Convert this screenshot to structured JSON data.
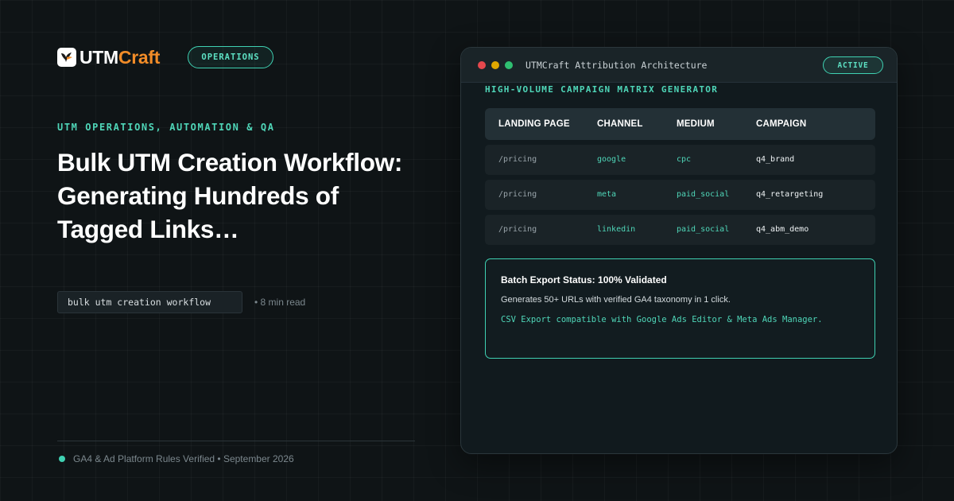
{
  "brand": {
    "name_part1": "UTM",
    "name_part2": "Craft",
    "logo_icon": "bird-icon",
    "category_pill": "OPERATIONS"
  },
  "article": {
    "eyebrow": "UTM OPERATIONS, AUTOMATION & QA",
    "headline": "Bulk UTM Creation Workflow: Generating Hundreds of Tagged Links…",
    "keyword": "bulk utm creation workflow",
    "read_time": "• 8 min read"
  },
  "footer": {
    "text": "GA4 & Ad Platform Rules Verified • September 2026"
  },
  "window": {
    "title": "UTMCraft Attribution Architecture",
    "status_pill": "ACTIVE",
    "section_label": "HIGH-VOLUME CAMPAIGN MATRIX GENERATOR",
    "table": {
      "headers": [
        "LANDING PAGE",
        "CHANNEL",
        "MEDIUM",
        "CAMPAIGN"
      ],
      "rows": [
        [
          "/pricing",
          "google",
          "cpc",
          "q4_brand"
        ],
        [
          "/pricing",
          "meta",
          "paid_social",
          "q4_retargeting"
        ],
        [
          "/pricing",
          "linkedin",
          "paid_social",
          "q4_abm_demo"
        ]
      ]
    },
    "status_card": {
      "title": "Batch Export Status: 100% Validated",
      "description": "Generates 50+ URLs with verified GA4 taxonomy in 1 click.",
      "note": "CSV Export compatible with Google Ads Editor & Meta Ads Manager."
    }
  },
  "colors": {
    "accent": "#3fd1b2",
    "brand_orange": "#f28c28",
    "background": "#0f1416",
    "dot_red": "#e5484d",
    "dot_yellow": "#e0a800",
    "dot_green": "#2fbf71"
  }
}
